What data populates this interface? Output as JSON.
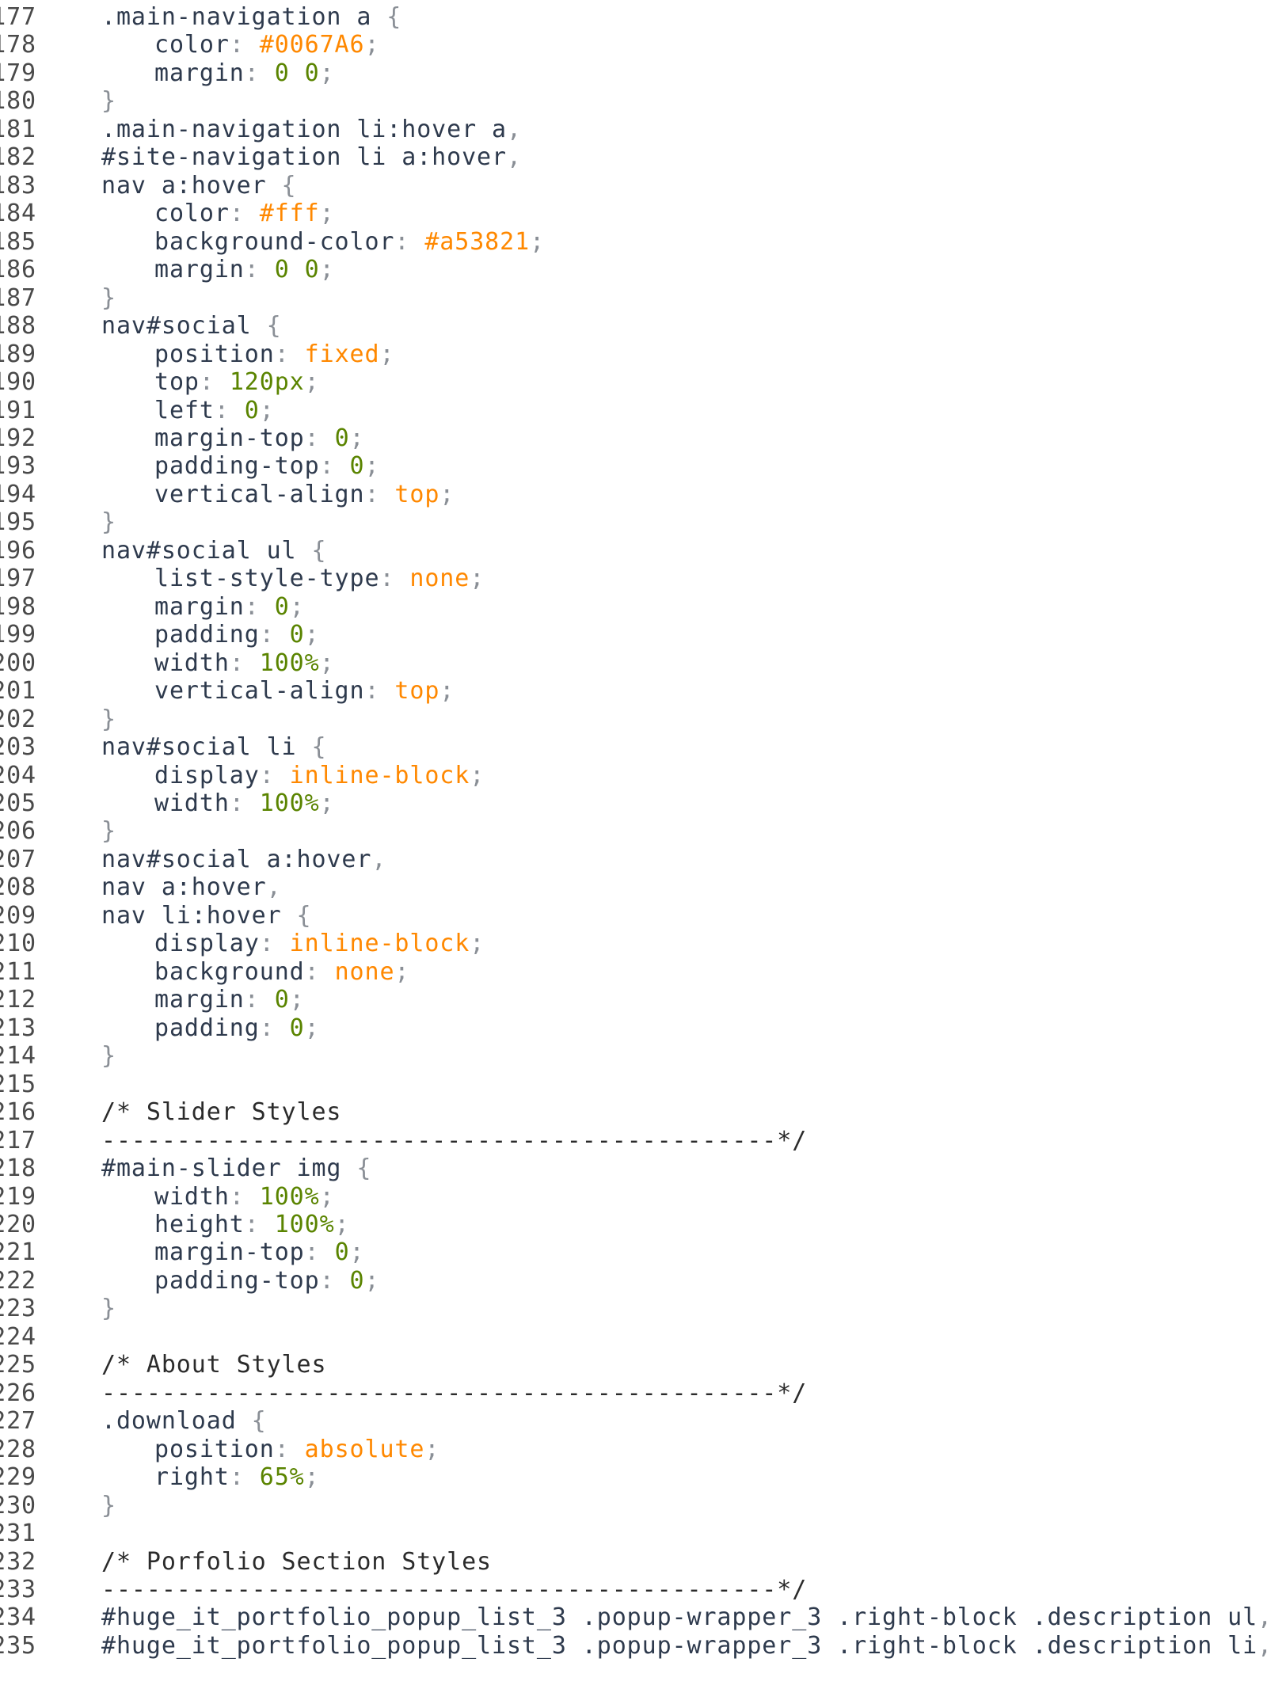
{
  "editor": {
    "colors": {
      "selector": "#2e3a4d",
      "property": "#2e3a4d",
      "punctuation": "#8a8f96",
      "keyword_value": "#ff8800",
      "numeric_value": "#5a8400",
      "comment": "#2b2b2b",
      "line_number": "#4a4a4a"
    },
    "lines": [
      {
        "num": "177",
        "indent": 0,
        "tokens": [
          {
            "t": "sel",
            "v": ".main-navigation a "
          },
          {
            "t": "punc",
            "v": "{"
          }
        ]
      },
      {
        "num": "178",
        "indent": 1,
        "tokens": [
          {
            "t": "prop",
            "v": "color"
          },
          {
            "t": "punc",
            "v": ": "
          },
          {
            "t": "val",
            "v": "#0067A6"
          },
          {
            "t": "punc",
            "v": ";"
          }
        ]
      },
      {
        "num": "179",
        "indent": 1,
        "tokens": [
          {
            "t": "prop",
            "v": "margin"
          },
          {
            "t": "punc",
            "v": ": "
          },
          {
            "t": "num",
            "v": "0 0"
          },
          {
            "t": "punc",
            "v": ";"
          }
        ]
      },
      {
        "num": "180",
        "indent": 0,
        "tokens": [
          {
            "t": "punc",
            "v": "}"
          }
        ]
      },
      {
        "num": "181",
        "indent": 0,
        "tokens": [
          {
            "t": "sel",
            "v": ".main-navigation li:hover a"
          },
          {
            "t": "punc",
            "v": ","
          }
        ]
      },
      {
        "num": "182",
        "indent": 0,
        "tokens": [
          {
            "t": "sel",
            "v": "#site-navigation li a:hover"
          },
          {
            "t": "punc",
            "v": ","
          }
        ]
      },
      {
        "num": "183",
        "indent": 0,
        "tokens": [
          {
            "t": "sel",
            "v": "nav a:hover "
          },
          {
            "t": "punc",
            "v": "{"
          }
        ]
      },
      {
        "num": "184",
        "indent": 1,
        "tokens": [
          {
            "t": "prop",
            "v": "color"
          },
          {
            "t": "punc",
            "v": ": "
          },
          {
            "t": "val",
            "v": "#fff"
          },
          {
            "t": "punc",
            "v": ";"
          }
        ]
      },
      {
        "num": "185",
        "indent": 1,
        "tokens": [
          {
            "t": "prop",
            "v": "background-color"
          },
          {
            "t": "punc",
            "v": ": "
          },
          {
            "t": "val",
            "v": "#a53821"
          },
          {
            "t": "punc",
            "v": ";"
          }
        ]
      },
      {
        "num": "186",
        "indent": 1,
        "tokens": [
          {
            "t": "prop",
            "v": "margin"
          },
          {
            "t": "punc",
            "v": ": "
          },
          {
            "t": "num",
            "v": "0 0"
          },
          {
            "t": "punc",
            "v": ";"
          }
        ]
      },
      {
        "num": "187",
        "indent": 0,
        "tokens": [
          {
            "t": "punc",
            "v": "}"
          }
        ]
      },
      {
        "num": "188",
        "indent": 0,
        "tokens": [
          {
            "t": "sel",
            "v": "nav#social "
          },
          {
            "t": "punc",
            "v": "{"
          }
        ]
      },
      {
        "num": "189",
        "indent": 1,
        "tokens": [
          {
            "t": "prop",
            "v": "position"
          },
          {
            "t": "punc",
            "v": ": "
          },
          {
            "t": "val",
            "v": "fixed"
          },
          {
            "t": "punc",
            "v": ";"
          }
        ]
      },
      {
        "num": "190",
        "indent": 1,
        "tokens": [
          {
            "t": "prop",
            "v": "top"
          },
          {
            "t": "punc",
            "v": ": "
          },
          {
            "t": "num",
            "v": "120px"
          },
          {
            "t": "punc",
            "v": ";"
          }
        ]
      },
      {
        "num": "191",
        "indent": 1,
        "tokens": [
          {
            "t": "prop",
            "v": "left"
          },
          {
            "t": "punc",
            "v": ": "
          },
          {
            "t": "num",
            "v": "0"
          },
          {
            "t": "punc",
            "v": ";"
          }
        ]
      },
      {
        "num": "192",
        "indent": 1,
        "tokens": [
          {
            "t": "prop",
            "v": "margin-top"
          },
          {
            "t": "punc",
            "v": ": "
          },
          {
            "t": "num",
            "v": "0"
          },
          {
            "t": "punc",
            "v": ";"
          }
        ]
      },
      {
        "num": "193",
        "indent": 1,
        "tokens": [
          {
            "t": "prop",
            "v": "padding-top"
          },
          {
            "t": "punc",
            "v": ": "
          },
          {
            "t": "num",
            "v": "0"
          },
          {
            "t": "punc",
            "v": ";"
          }
        ]
      },
      {
        "num": "194",
        "indent": 1,
        "tokens": [
          {
            "t": "prop",
            "v": "vertical-align"
          },
          {
            "t": "punc",
            "v": ": "
          },
          {
            "t": "val",
            "v": "top"
          },
          {
            "t": "punc",
            "v": ";"
          }
        ]
      },
      {
        "num": "195",
        "indent": 0,
        "tokens": [
          {
            "t": "punc",
            "v": "}"
          }
        ]
      },
      {
        "num": "196",
        "indent": 0,
        "tokens": [
          {
            "t": "sel",
            "v": "nav#social ul "
          },
          {
            "t": "punc",
            "v": "{"
          }
        ]
      },
      {
        "num": "197",
        "indent": 1,
        "tokens": [
          {
            "t": "prop",
            "v": "list-style-type"
          },
          {
            "t": "punc",
            "v": ": "
          },
          {
            "t": "val",
            "v": "none"
          },
          {
            "t": "punc",
            "v": ";"
          }
        ]
      },
      {
        "num": "198",
        "indent": 1,
        "tokens": [
          {
            "t": "prop",
            "v": "margin"
          },
          {
            "t": "punc",
            "v": ": "
          },
          {
            "t": "num",
            "v": "0"
          },
          {
            "t": "punc",
            "v": ";"
          }
        ]
      },
      {
        "num": "199",
        "indent": 1,
        "tokens": [
          {
            "t": "prop",
            "v": "padding"
          },
          {
            "t": "punc",
            "v": ": "
          },
          {
            "t": "num",
            "v": "0"
          },
          {
            "t": "punc",
            "v": ";"
          }
        ]
      },
      {
        "num": "200",
        "indent": 1,
        "tokens": [
          {
            "t": "prop",
            "v": "width"
          },
          {
            "t": "punc",
            "v": ": "
          },
          {
            "t": "num",
            "v": "100%"
          },
          {
            "t": "punc",
            "v": ";"
          }
        ]
      },
      {
        "num": "201",
        "indent": 1,
        "tokens": [
          {
            "t": "prop",
            "v": "vertical-align"
          },
          {
            "t": "punc",
            "v": ": "
          },
          {
            "t": "val",
            "v": "top"
          },
          {
            "t": "punc",
            "v": ";"
          }
        ]
      },
      {
        "num": "202",
        "indent": 0,
        "tokens": [
          {
            "t": "punc",
            "v": "}"
          }
        ]
      },
      {
        "num": "203",
        "indent": 0,
        "tokens": [
          {
            "t": "sel",
            "v": "nav#social li "
          },
          {
            "t": "punc",
            "v": "{"
          }
        ]
      },
      {
        "num": "204",
        "indent": 1,
        "tokens": [
          {
            "t": "prop",
            "v": "display"
          },
          {
            "t": "punc",
            "v": ": "
          },
          {
            "t": "val",
            "v": "inline-block"
          },
          {
            "t": "punc",
            "v": ";"
          }
        ]
      },
      {
        "num": "205",
        "indent": 1,
        "tokens": [
          {
            "t": "prop",
            "v": "width"
          },
          {
            "t": "punc",
            "v": ": "
          },
          {
            "t": "num",
            "v": "100%"
          },
          {
            "t": "punc",
            "v": ";"
          }
        ]
      },
      {
        "num": "206",
        "indent": 0,
        "tokens": [
          {
            "t": "punc",
            "v": "}"
          }
        ]
      },
      {
        "num": "207",
        "indent": 0,
        "tokens": [
          {
            "t": "sel",
            "v": "nav#social a:hover"
          },
          {
            "t": "punc",
            "v": ","
          }
        ]
      },
      {
        "num": "208",
        "indent": 0,
        "tokens": [
          {
            "t": "sel",
            "v": "nav a:hover"
          },
          {
            "t": "punc",
            "v": ","
          }
        ]
      },
      {
        "num": "209",
        "indent": 0,
        "tokens": [
          {
            "t": "sel",
            "v": "nav li:hover "
          },
          {
            "t": "punc",
            "v": "{"
          }
        ]
      },
      {
        "num": "210",
        "indent": 1,
        "tokens": [
          {
            "t": "prop",
            "v": "display"
          },
          {
            "t": "punc",
            "v": ": "
          },
          {
            "t": "val",
            "v": "inline-block"
          },
          {
            "t": "punc",
            "v": ";"
          }
        ]
      },
      {
        "num": "211",
        "indent": 1,
        "tokens": [
          {
            "t": "prop",
            "v": "background"
          },
          {
            "t": "punc",
            "v": ": "
          },
          {
            "t": "val",
            "v": "none"
          },
          {
            "t": "punc",
            "v": ";"
          }
        ]
      },
      {
        "num": "212",
        "indent": 1,
        "tokens": [
          {
            "t": "prop",
            "v": "margin"
          },
          {
            "t": "punc",
            "v": ": "
          },
          {
            "t": "num",
            "v": "0"
          },
          {
            "t": "punc",
            "v": ";"
          }
        ]
      },
      {
        "num": "213",
        "indent": 1,
        "tokens": [
          {
            "t": "prop",
            "v": "padding"
          },
          {
            "t": "punc",
            "v": ": "
          },
          {
            "t": "num",
            "v": "0"
          },
          {
            "t": "punc",
            "v": ";"
          }
        ]
      },
      {
        "num": "214",
        "indent": 0,
        "tokens": [
          {
            "t": "punc",
            "v": "}"
          }
        ]
      },
      {
        "num": "215",
        "indent": 0,
        "tokens": []
      },
      {
        "num": "216",
        "indent": 0,
        "tokens": [
          {
            "t": "com",
            "v": "/* Slider Styles"
          }
        ]
      },
      {
        "num": "217",
        "indent": 0,
        "tokens": [
          {
            "t": "com",
            "v": "---------------------------------------------*/"
          }
        ]
      },
      {
        "num": "218",
        "indent": 0,
        "tokens": [
          {
            "t": "sel",
            "v": "#main-slider img "
          },
          {
            "t": "punc",
            "v": "{"
          }
        ]
      },
      {
        "num": "219",
        "indent": 1,
        "tokens": [
          {
            "t": "prop",
            "v": "width"
          },
          {
            "t": "punc",
            "v": ": "
          },
          {
            "t": "num",
            "v": "100%"
          },
          {
            "t": "punc",
            "v": ";"
          }
        ]
      },
      {
        "num": "220",
        "indent": 1,
        "tokens": [
          {
            "t": "prop",
            "v": "height"
          },
          {
            "t": "punc",
            "v": ": "
          },
          {
            "t": "num",
            "v": "100%"
          },
          {
            "t": "punc",
            "v": ";"
          }
        ]
      },
      {
        "num": "221",
        "indent": 1,
        "tokens": [
          {
            "t": "prop",
            "v": "margin-top"
          },
          {
            "t": "punc",
            "v": ": "
          },
          {
            "t": "num",
            "v": "0"
          },
          {
            "t": "punc",
            "v": ";"
          }
        ]
      },
      {
        "num": "222",
        "indent": 1,
        "tokens": [
          {
            "t": "prop",
            "v": "padding-top"
          },
          {
            "t": "punc",
            "v": ": "
          },
          {
            "t": "num",
            "v": "0"
          },
          {
            "t": "punc",
            "v": ";"
          }
        ]
      },
      {
        "num": "223",
        "indent": 0,
        "tokens": [
          {
            "t": "punc",
            "v": "}"
          }
        ]
      },
      {
        "num": "224",
        "indent": 0,
        "tokens": []
      },
      {
        "num": "225",
        "indent": 0,
        "tokens": [
          {
            "t": "com",
            "v": "/* About Styles"
          }
        ]
      },
      {
        "num": "226",
        "indent": 0,
        "tokens": [
          {
            "t": "com",
            "v": "---------------------------------------------*/"
          }
        ]
      },
      {
        "num": "227",
        "indent": 0,
        "tokens": [
          {
            "t": "sel",
            "v": ".download "
          },
          {
            "t": "punc",
            "v": "{"
          }
        ]
      },
      {
        "num": "228",
        "indent": 1,
        "tokens": [
          {
            "t": "prop",
            "v": "position"
          },
          {
            "t": "punc",
            "v": ": "
          },
          {
            "t": "val",
            "v": "absolute"
          },
          {
            "t": "punc",
            "v": ";"
          }
        ]
      },
      {
        "num": "229",
        "indent": 1,
        "tokens": [
          {
            "t": "prop",
            "v": "right"
          },
          {
            "t": "punc",
            "v": ": "
          },
          {
            "t": "num",
            "v": "65%"
          },
          {
            "t": "punc",
            "v": ";"
          }
        ]
      },
      {
        "num": "230",
        "indent": 0,
        "tokens": [
          {
            "t": "punc",
            "v": "}"
          }
        ]
      },
      {
        "num": "231",
        "indent": 0,
        "tokens": []
      },
      {
        "num": "232",
        "indent": 0,
        "tokens": [
          {
            "t": "com",
            "v": "/* Porfolio Section Styles"
          }
        ]
      },
      {
        "num": "233",
        "indent": 0,
        "tokens": [
          {
            "t": "com",
            "v": "---------------------------------------------*/"
          }
        ]
      },
      {
        "num": "234",
        "indent": 0,
        "tokens": [
          {
            "t": "sel",
            "v": "#huge_it_portfolio_popup_list_3 .popup-wrapper_3 .right-block .description ul"
          },
          {
            "t": "punc",
            "v": ","
          }
        ]
      },
      {
        "num": "235",
        "indent": 0,
        "tokens": [
          {
            "t": "sel",
            "v": "#huge_it_portfolio_popup_list_3 .popup-wrapper_3 .right-block .description li"
          },
          {
            "t": "punc",
            "v": ","
          }
        ]
      }
    ]
  }
}
